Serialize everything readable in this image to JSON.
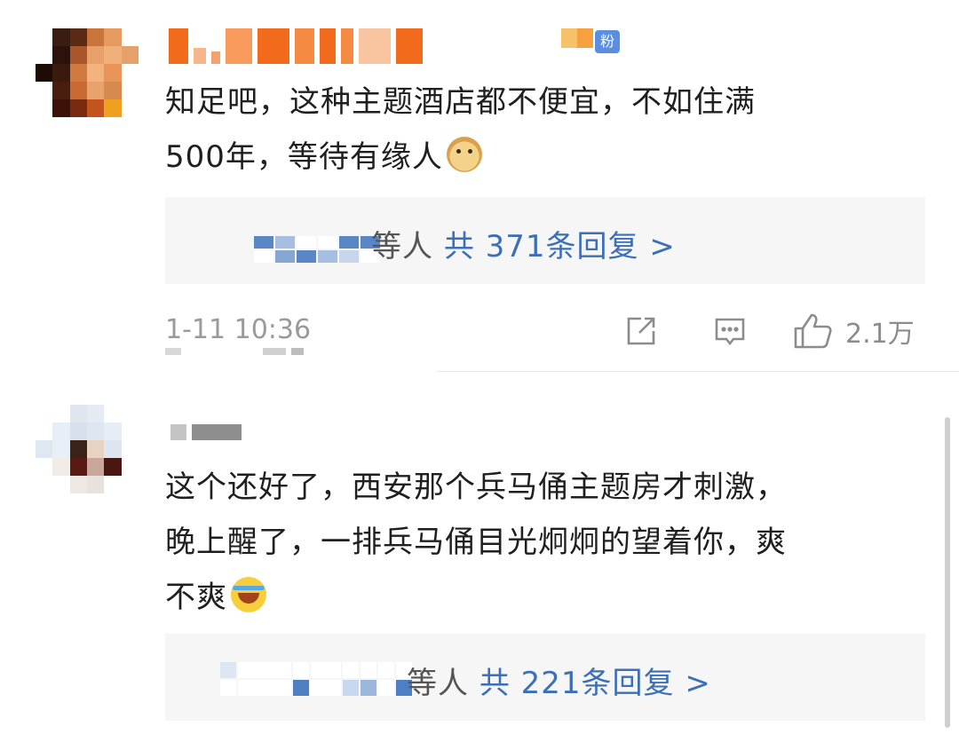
{
  "comments": [
    {
      "fan_badge": "粉",
      "text_line1": "知足吧，这种主题酒店都不便宜，不如住满",
      "text_line2": "500年，等待有缘人",
      "emoji": "doge-emoji",
      "reply_label": "等人",
      "reply_link": "共 371条回复 >",
      "timestamp": "1-11 10:36",
      "like_count": "2.1万"
    },
    {
      "text_line1": "这个还好了，西安那个兵马俑主题房才刺激，",
      "text_line2": "晚上醒了，一排兵马俑目光炯炯的望着你，爽",
      "text_line3": "不爽",
      "emoji": "laugh-cry-emoji",
      "reply_label": "等人",
      "reply_link": "共 221条回复 >"
    }
  ],
  "icons": {
    "share": "share-icon",
    "comment": "comment-icon",
    "like": "thumbs-up-icon"
  },
  "colors": {
    "link": "#3b6fb6",
    "badge": "#5a8fe0",
    "meta_gray": "#9a9a9a",
    "reply_bg": "#f6f6f6"
  }
}
